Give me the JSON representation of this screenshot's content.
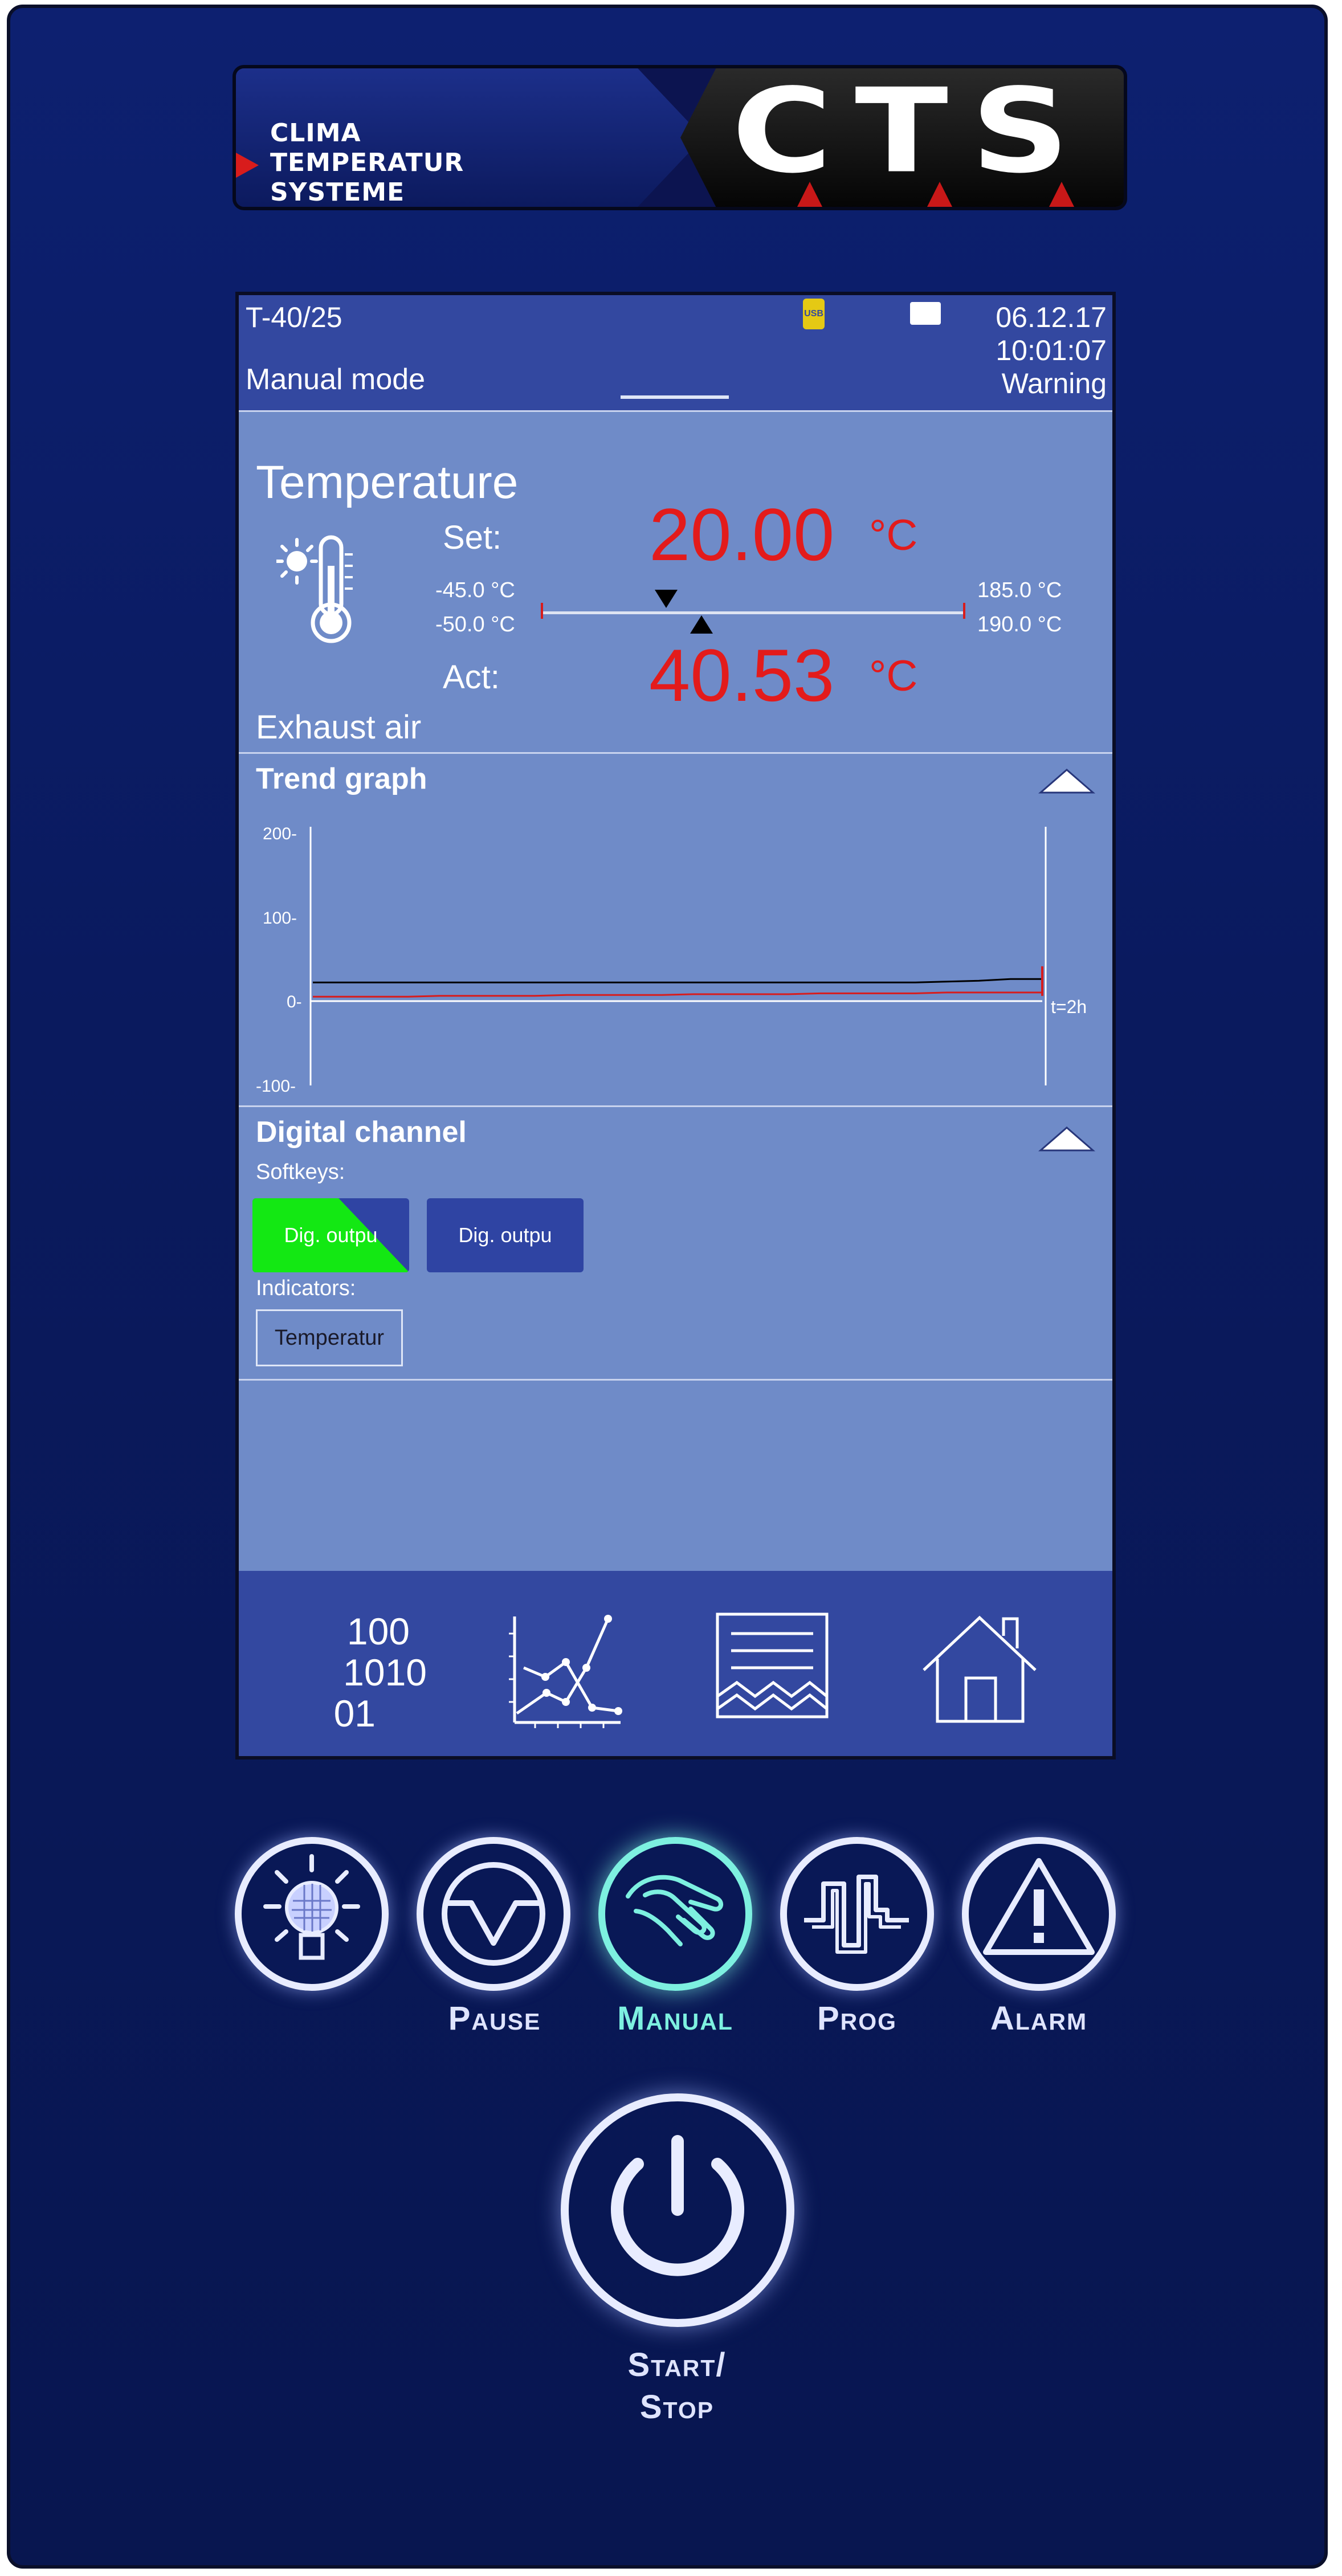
{
  "brand": {
    "line1": "CLIMA",
    "line2": "TEMPERATUR",
    "line3": "SYSTEME",
    "logo": "CTS",
    "accent": "#d81c1c"
  },
  "status_bar": {
    "device": "T-40/25",
    "mode": "Manual mode",
    "date": "06.12.17",
    "time": "10:01:07",
    "status": "Warning",
    "usb_label": "USB"
  },
  "temperature": {
    "title": "Temperature",
    "set_label": "Set:",
    "set_value": "20.00",
    "act_label": "Act:",
    "act_value": "40.53",
    "unit": "°C",
    "warn_low": "-45.0 °C",
    "alarm_low": "-50.0 °C",
    "warn_high": "185.0 °C",
    "alarm_high": "190.0 °C",
    "sensor": "Exhaust air",
    "value_color": "#e31b1b"
  },
  "trend": {
    "title": "Trend graph",
    "time_label": "t=2h",
    "chart_data": {
      "type": "line",
      "y_ticks": [
        "200-",
        "100-",
        "0-",
        "-100-"
      ],
      "ylim": [
        -100,
        200
      ],
      "series": [
        {
          "color": "#000000",
          "values": [
            20,
            20,
            20,
            20,
            20,
            20,
            20,
            20,
            20,
            20,
            20,
            20,
            20,
            20,
            20,
            20,
            20,
            20,
            20,
            20,
            21,
            22,
            24,
            24
          ]
        },
        {
          "color": "#d81c1c",
          "values": [
            3,
            3,
            3,
            3,
            4,
            4,
            4,
            4,
            5,
            5,
            5,
            5,
            6,
            6,
            6,
            6,
            7,
            7,
            7,
            7,
            8,
            8,
            8,
            8
          ]
        }
      ]
    }
  },
  "digital": {
    "title": "Digital channel",
    "softkeys_label": "Softkeys:",
    "softkeys": [
      {
        "label": "Dig. outpu",
        "active": true
      },
      {
        "label": "Dig. outpu",
        "active": false
      }
    ],
    "indicators_label": "Indicators:",
    "indicators": [
      "Temperatur"
    ]
  },
  "navbar": {
    "items": [
      {
        "icon": "binary-values-icon",
        "line1": "100",
        "line2": "1010",
        "line3": "01"
      },
      {
        "icon": "line-chart-icon"
      },
      {
        "icon": "log-document-icon"
      },
      {
        "icon": "home-icon"
      }
    ]
  },
  "hardware_buttons": [
    {
      "icon": "light-icon",
      "label": ""
    },
    {
      "icon": "pause-icon",
      "label": "Pause"
    },
    {
      "icon": "manual-hand-icon",
      "label": "Manual",
      "active": true
    },
    {
      "icon": "program-icon",
      "label": "Prog"
    },
    {
      "icon": "alarm-triangle-icon",
      "label": "Alarm"
    }
  ],
  "power": {
    "line1": "Start/",
    "line2": "Stop",
    "icon": "power-icon"
  },
  "colors": {
    "panel": "#0d2070",
    "screen_bg": "#6f8bc8",
    "bar_bg": "#3348a0",
    "active_softkey": "#13e813",
    "active_button": "#7df0e0"
  }
}
